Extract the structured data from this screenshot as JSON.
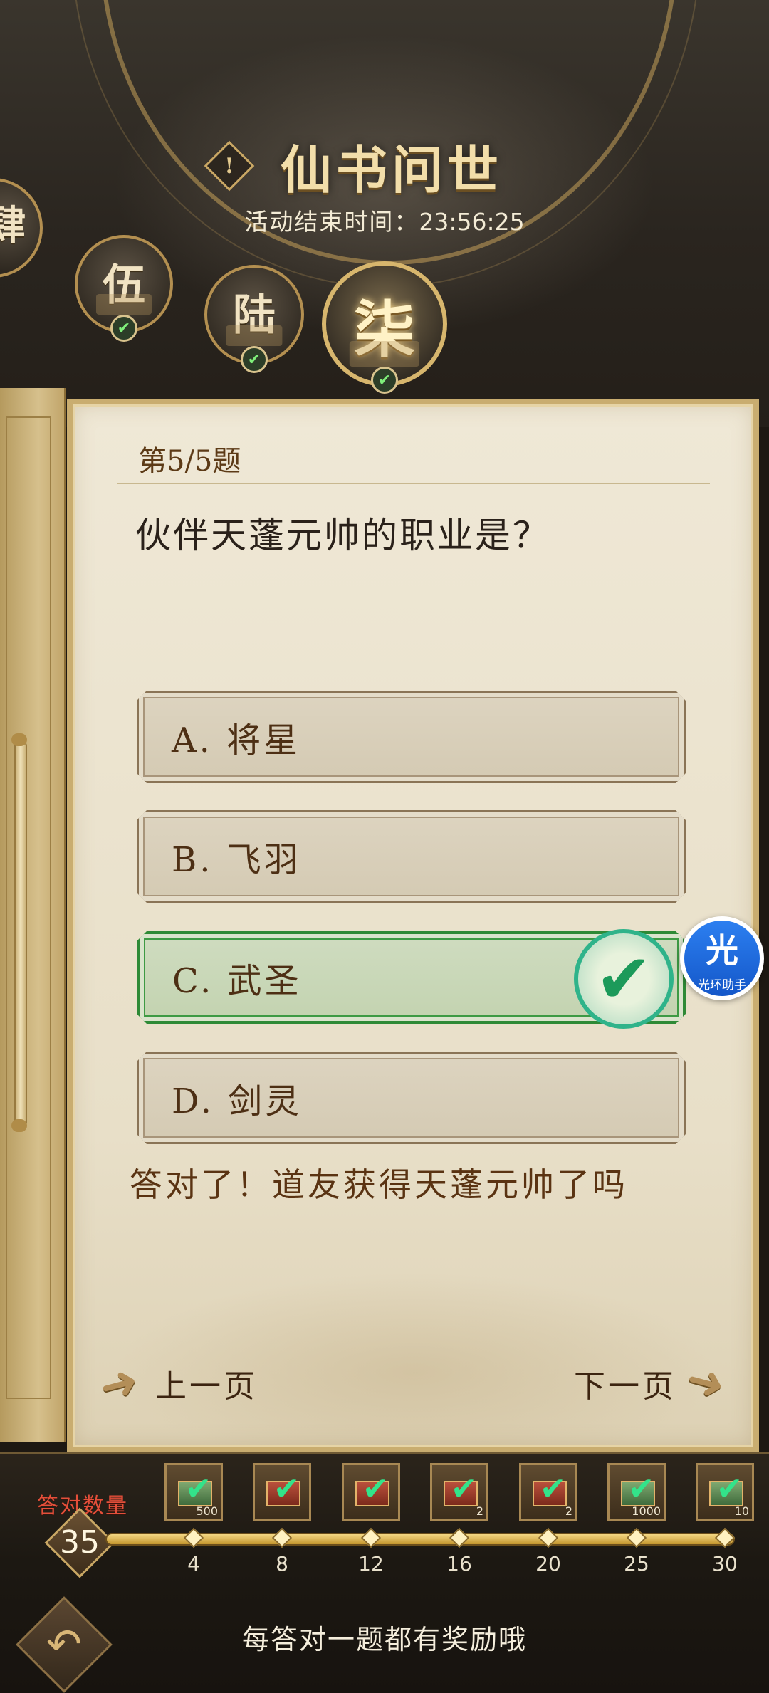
{
  "header": {
    "title": "仙书问世",
    "end_time_label": "活动结束时间：",
    "end_time_value": "23:56:25",
    "info_icon": "!"
  },
  "chapters": [
    {
      "label": "肆",
      "completed": true
    },
    {
      "label": "伍",
      "completed": true
    },
    {
      "label": "陆",
      "completed": true
    },
    {
      "label": "柒",
      "completed": true,
      "active": true
    }
  ],
  "question": {
    "number": "第5/5题",
    "text": "伙伴天蓬元帅的职业是？",
    "options": [
      {
        "label": "A. 将星",
        "correct": false
      },
      {
        "label": "B. 飞羽",
        "correct": false
      },
      {
        "label": "C. 武圣",
        "correct": true
      },
      {
        "label": "D. 剑灵",
        "correct": false
      }
    ],
    "feedback": "答对了！道友获得天蓬元帅了吗"
  },
  "navigation": {
    "prev_label": "上一页",
    "next_label": "下一页"
  },
  "helper": {
    "glyph": "光",
    "caption": "光环助手"
  },
  "rewards": {
    "count_label": "答对数量",
    "count_value": "35",
    "progress_fraction": 1.0,
    "milestones": [
      {
        "threshold": "4",
        "qty": "500",
        "kind": "green",
        "claimed": true
      },
      {
        "threshold": "8",
        "qty": "",
        "kind": "red",
        "claimed": true
      },
      {
        "threshold": "12",
        "qty": "",
        "kind": "red",
        "claimed": true
      },
      {
        "threshold": "16",
        "qty": "2",
        "kind": "red",
        "claimed": true
      },
      {
        "threshold": "20",
        "qty": "2",
        "kind": "red",
        "claimed": true
      },
      {
        "threshold": "25",
        "qty": "1000",
        "kind": "green",
        "claimed": true
      },
      {
        "threshold": "30",
        "qty": "10",
        "kind": "green",
        "claimed": true
      }
    ],
    "hint": "每答对一题都有奖励哦"
  },
  "colors": {
    "accent_gold": "#c9a764",
    "correct_green": "#2e8a36",
    "count_red": "#e44f3a",
    "helper_blue": "#1f6ee0"
  }
}
